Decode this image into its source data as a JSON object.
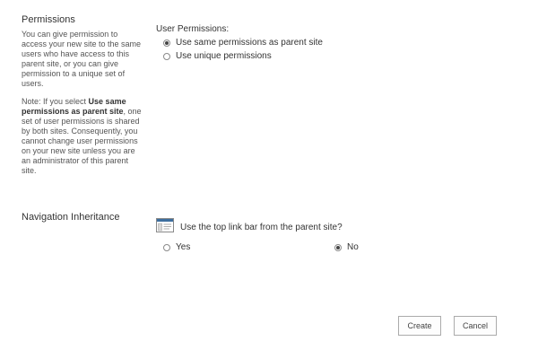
{
  "permissions": {
    "title": "Permissions",
    "desc1": "You can give permission to access your new site to the same users who have access to this parent site, or you can give permission to a unique set of users.",
    "note_prefix": "Note: If you select ",
    "note_bold": "Use same permissions as parent site",
    "note_suffix": ", one set of user permissions is shared by both sites. Consequently, you cannot change user permissions on your new site unless you are an administrator of this parent site.",
    "field_label": "User Permissions:",
    "options": [
      {
        "label": "Use same permissions as parent site",
        "selected": true
      },
      {
        "label": "Use unique permissions",
        "selected": false
      }
    ]
  },
  "navigation": {
    "title": "Navigation Inheritance",
    "icon": "top-link-bar-icon",
    "question": "Use the top link bar from the parent site?",
    "options": [
      {
        "label": "Yes",
        "selected": false
      },
      {
        "label": "No",
        "selected": true
      }
    ]
  },
  "buttons": {
    "create": "Create",
    "cancel": "Cancel"
  }
}
